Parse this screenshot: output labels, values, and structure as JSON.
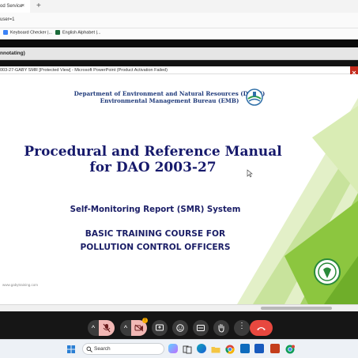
{
  "browser": {
    "tab_title": "od Service",
    "tab_close": "×",
    "new_tab": "+",
    "address": "user=1",
    "bookmarks": [
      {
        "label": "Keyboard Checker |...",
        "color": "#3b82f6"
      },
      {
        "label": "English Alphabet |...",
        "color": "#1b6b3a"
      }
    ]
  },
  "meeting": {
    "annotation_banner": "nnotating)"
  },
  "powerpoint": {
    "window_title": "003-27-GABY SMR [Protected View] - Microsoft PowerPoint (Product Activation Failed)"
  },
  "slide": {
    "org_line1": "Department of Environment and Natural Resources (DENR)",
    "org_line2": "Environmental Management Bureau (EMB)",
    "title_line1": "Procedural and Reference Manual",
    "title_line2": "for DAO 2003-27",
    "subtitle": "Self-Monitoring Report (SMR) System",
    "course_line1": "BASIC TRAINING COURSE FOR",
    "course_line2": "POLLUTION CONTROL OFFICERS",
    "website": "www.gabytraining.com",
    "colors": {
      "title": "#16196b",
      "org": "#1f3a7a",
      "accent_green": "#8cc63f"
    }
  },
  "controls": {
    "buttons": [
      {
        "name": "mic-options",
        "icon": "chevron-up-icon"
      },
      {
        "name": "mic",
        "icon": "mic-off-icon",
        "state": "muted"
      },
      {
        "name": "camera-options",
        "icon": "chevron-up-icon"
      },
      {
        "name": "camera",
        "icon": "camera-off-icon",
        "state": "off",
        "badge": "!"
      },
      {
        "name": "present",
        "icon": "present-icon"
      },
      {
        "name": "reactions",
        "icon": "emoji-icon"
      },
      {
        "name": "captions",
        "icon": "captions-icon"
      },
      {
        "name": "raise-hand",
        "icon": "hand-icon"
      },
      {
        "name": "more",
        "icon": "more-icon"
      },
      {
        "name": "leave-call",
        "icon": "phone-hangup-icon",
        "color": "#e8483f"
      }
    ]
  },
  "taskbar": {
    "search_placeholder": "Search",
    "apps": [
      "windows-start",
      "copilot",
      "task-view",
      "edge",
      "file-explorer",
      "chrome",
      "outlook",
      "word",
      "excel",
      "powerpoint",
      "chrome-profile"
    ]
  }
}
